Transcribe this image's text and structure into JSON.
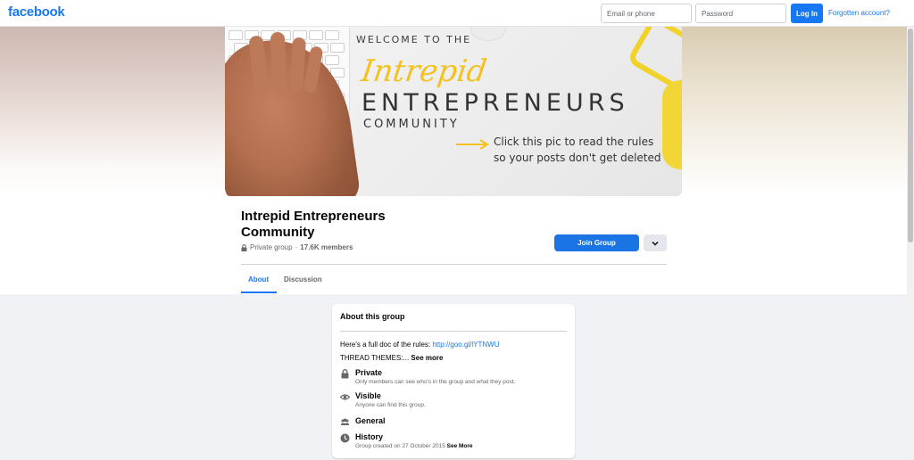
{
  "topbar": {
    "logo": "facebook",
    "email_placeholder": "Email or phone",
    "password_placeholder": "Password",
    "login_label": "Log In",
    "forgot_label": "Forgotten account?"
  },
  "cover": {
    "welcome": "WELCOME TO THE",
    "intrepid": "Intrepid",
    "entrepreneurs": "ENTREPRENEURS",
    "community": "COMMUNITY",
    "click_line1": "Click this pic to read the rules",
    "click_line2": "so your posts don't get deleted"
  },
  "group": {
    "title": "Intrepid Entrepreneurs Community",
    "privacy": "Private group",
    "separator": "·",
    "members": "17.6K members",
    "join_label": "Join Group"
  },
  "tabs": [
    {
      "label": "About",
      "active": true
    },
    {
      "label": "Discussion",
      "active": false
    }
  ],
  "about": {
    "title": "About this group",
    "desc_prefix": "Here's a full doc of the rules: ",
    "desc_link": "http://goo.gl/lYTNWU",
    "thread_prefix": "THREAD THEMES:... ",
    "thread_see_more": "See more",
    "items": [
      {
        "icon": "lock-icon",
        "title": "Private",
        "sub": "Only members can see who's in the group and what they post."
      },
      {
        "icon": "eye-icon",
        "title": "Visible",
        "sub": "Anyone can find this group."
      },
      {
        "icon": "people-icon",
        "title": "General",
        "sub": ""
      },
      {
        "icon": "clock-icon",
        "title": "History",
        "sub": "Group created on 27 October 2015",
        "see_more": "See More"
      }
    ]
  },
  "colors": {
    "brand": "#1877f2",
    "join_button": "#1b74e4",
    "page_bg": "#f0f2f5"
  }
}
